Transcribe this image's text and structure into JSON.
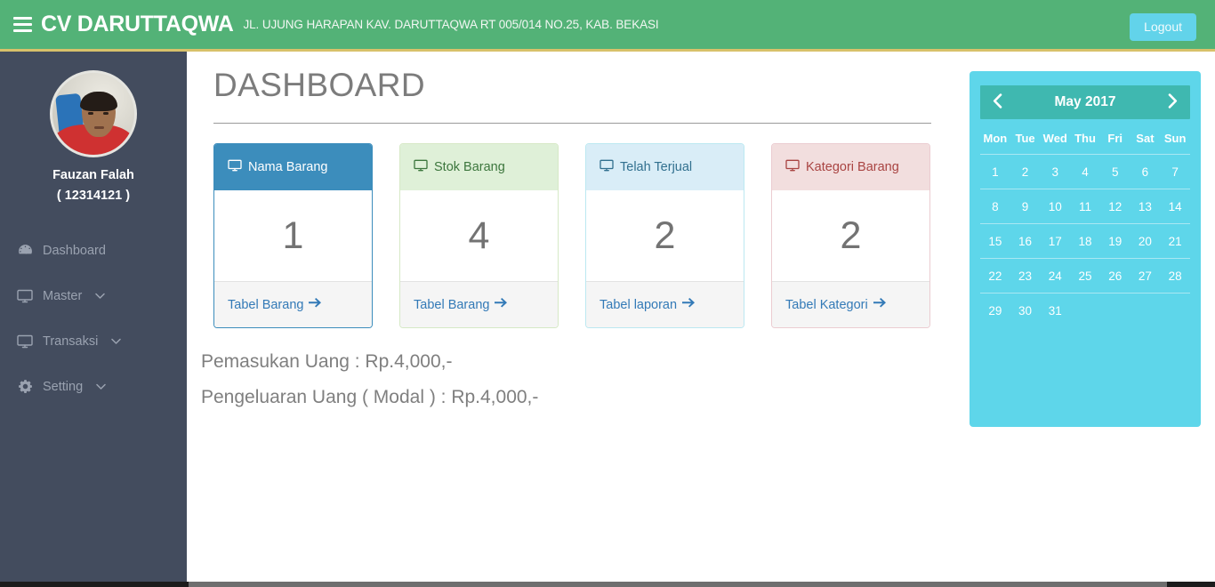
{
  "navbar": {
    "menu_toggle_icon": "hamburger-icon",
    "brand": "CV DARUTTAQWA",
    "address": "JL. UJUNG HARAPAN KAV. DARUTTAQWA RT 005/014 NO.25, KAB. BEKASI",
    "logout_label": "Logout",
    "bg_color": "#53b277",
    "accent_border": "#d8c16a",
    "logout_color": "#62d3ea"
  },
  "sidebar": {
    "bg_color": "#434c5e",
    "user_name": "Fauzan Falah",
    "user_id": "( 12314121 )",
    "avatar_icon": "user-photo",
    "items": [
      {
        "label": "Dashboard",
        "icon": "dashboard-icon",
        "has_caret": false
      },
      {
        "label": "Master",
        "icon": "monitor-icon",
        "has_caret": true
      },
      {
        "label": "Transaksi",
        "icon": "monitor-icon",
        "has_caret": true
      },
      {
        "label": "Setting",
        "icon": "gear-icon",
        "has_caret": true
      }
    ]
  },
  "main": {
    "page_title": "DASHBOARD",
    "cards": [
      {
        "title": "Nama Barang",
        "icon": "monitor-icon",
        "value": "1",
        "link_label": "Tabel Barang",
        "link_icon": "arrow-right-icon",
        "style": "blue",
        "header_color": "#3c8dbc"
      },
      {
        "title": "Stok Barang",
        "icon": "monitor-icon",
        "value": "4",
        "link_label": "Tabel Barang",
        "link_icon": "arrow-right-icon",
        "style": "green",
        "header_color": "#dff0d8"
      },
      {
        "title": "Telah Terjual",
        "icon": "monitor-icon",
        "value": "2",
        "link_label": "Tabel laporan",
        "link_icon": "arrow-right-icon",
        "style": "info",
        "header_color": "#d9edf7"
      },
      {
        "title": "Kategori Barang",
        "icon": "monitor-icon",
        "value": "2",
        "link_label": "Tabel Kategori",
        "link_icon": "arrow-right-icon",
        "style": "danger",
        "header_color": "#f2dede"
      }
    ],
    "income_line": "Pemasukan Uang : Rp.4,000,-",
    "expense_line": "Pengeluaran Uang ( Modal ) : Rp.4,000,-"
  },
  "calendar": {
    "bg_color": "#5ed6ea",
    "header_color": "#3fb8b0",
    "prev_icon": "chevron-left-icon",
    "next_icon": "chevron-right-icon",
    "month_label": "May 2017",
    "day_headers": [
      "Mon",
      "Tue",
      "Wed",
      "Thu",
      "Fri",
      "Sat",
      "Sun"
    ],
    "weeks": [
      [
        "1",
        "2",
        "3",
        "4",
        "5",
        "6",
        "7"
      ],
      [
        "8",
        "9",
        "10",
        "11",
        "12",
        "13",
        "14"
      ],
      [
        "15",
        "16",
        "17",
        "18",
        "19",
        "20",
        "21"
      ],
      [
        "22",
        "23",
        "24",
        "25",
        "26",
        "27",
        "28"
      ],
      [
        "29",
        "30",
        "31",
        "",
        "",
        "",
        ""
      ]
    ]
  }
}
